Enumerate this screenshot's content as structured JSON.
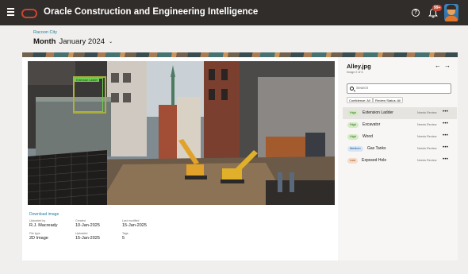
{
  "header": {
    "app_title": "Oracle Construction and Engineering Intelligence",
    "notification_count": "99+",
    "help_glyph": "?"
  },
  "breadcrumb": "Racoon City",
  "period": {
    "label": "Month",
    "value": "January 2024"
  },
  "image": {
    "annotation_label": "Extension Ladder",
    "download_label": "Download image"
  },
  "metadata": {
    "uploaded_by_label": "Uploaded by",
    "uploaded_by": "R.J. Macready",
    "created_label": "Created",
    "created": "10-Jan-2025",
    "last_modified_label": "Last modified",
    "last_modified": "15-Jan-2025",
    "file_type_label": "File type",
    "file_type": "2D Image",
    "uploaded_label": "Uploaded",
    "uploaded": "15-Jan-2025",
    "tags_label": "Tags",
    "tags": "5"
  },
  "side": {
    "title": "Alley.jpg",
    "subtitle": "Image 2 of 6",
    "prev_glyph": "←",
    "next_glyph": "→",
    "search_placeholder": "Search",
    "filters": [
      "Confidence: All",
      "Review Status: All"
    ],
    "items": [
      {
        "confidence": "High",
        "label": "Extension Ladder",
        "status": "Needs Review"
      },
      {
        "confidence": "High",
        "label": "Excavator",
        "status": "Needs Review"
      },
      {
        "confidence": "High",
        "label": "Wood",
        "status": "Needs Review"
      },
      {
        "confidence": "Medium",
        "label": "Gas Tanks",
        "status": "Needs Review"
      },
      {
        "confidence": "Low",
        "label": "Exposed Hole",
        "status": "Needs Review"
      }
    ],
    "more_glyph": "•••"
  },
  "colors": {
    "topbar": "#312d2a",
    "brand_red": "#c74634",
    "link": "#227e9e",
    "annotation_green": "#6fd051"
  },
  "icons": [
    "hamburger-icon",
    "oracle-logo",
    "help-icon",
    "bell-icon",
    "avatar",
    "arrow-left-icon",
    "arrow-right-icon",
    "search-icon",
    "more-icon",
    "chevron-down-icon"
  ]
}
